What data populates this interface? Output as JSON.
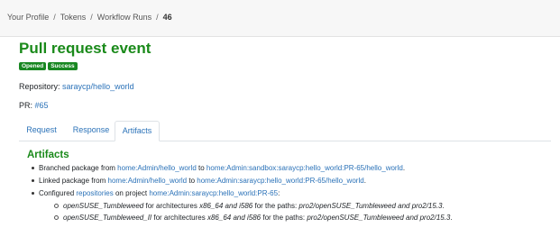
{
  "breadcrumb": {
    "items": [
      "Your Profile",
      "Tokens",
      "Workflow Runs"
    ],
    "current": "46",
    "separator": "/"
  },
  "header": {
    "title": "Pull request event",
    "badges": [
      "Opened",
      "Success"
    ]
  },
  "info": {
    "repository_label": "Repository:",
    "repository_value": "saraycp/hello_world",
    "pr_label": "PR:",
    "pr_value": "#65"
  },
  "tabs": [
    {
      "label": "Request"
    },
    {
      "label": "Response"
    },
    {
      "label": "Artifacts",
      "active": true
    }
  ],
  "artifacts": {
    "title": "Artifacts",
    "branched": {
      "prefix": "Branched package from",
      "from": "home:Admin/hello_world",
      "to_word": "to",
      "to": "home:Admin:sandbox:saraycp:hello_world:PR-65/hello_world",
      "end": "."
    },
    "linked": {
      "prefix": "Linked package from",
      "from": "home:Admin/hello_world",
      "to_word": "to",
      "to": "home:Admin:saraycp:hello_world:PR-65/hello_world",
      "end": "."
    },
    "configured": {
      "prefix": "Configured",
      "link": "repositories",
      "middle": "on project",
      "project": "home:Admin:saraycp:hello_world:PR-65",
      "end": ":"
    },
    "repos": [
      {
        "name": "openSUSE_Tumbleweed",
        "for_text": "for architectures",
        "archs": "x86_64 and i586",
        "paths_text": "for the paths:",
        "paths": "pro2/openSUSE_Tumbleweed and pro2/15.3",
        "end": "."
      },
      {
        "name": "openSUSE_Tumbleweed_II",
        "for_text": "for architectures",
        "archs": "x86_64 and i586",
        "paths_text": "for the paths:",
        "paths": "pro2/openSUSE_Tumbleweed and pro2/15.3",
        "end": "."
      }
    ]
  },
  "colors": {
    "accent_green": "#1a8a1a",
    "badge_green": "#198722",
    "link_blue": "#2b72b8"
  }
}
